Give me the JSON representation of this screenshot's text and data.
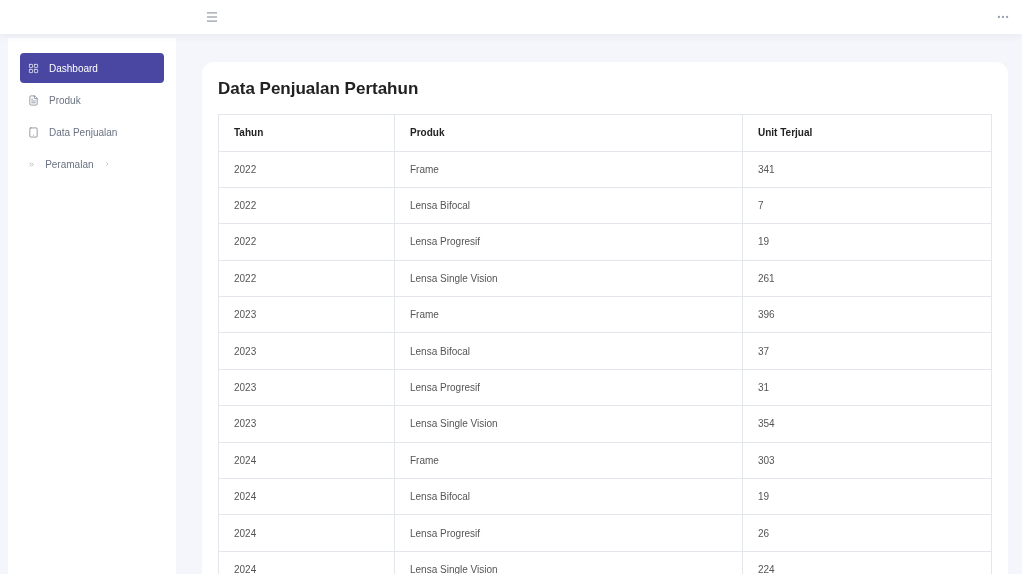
{
  "sidebar": {
    "items": [
      {
        "kind": "grid",
        "label": "Dashboard",
        "selected": true
      },
      {
        "kind": "file",
        "label": "Produk",
        "selected": false
      },
      {
        "kind": "book",
        "label": "Data Penjualan",
        "selected": false
      },
      {
        "kind": "submenu",
        "label": "Peramalan",
        "selected": false
      }
    ]
  },
  "title": "Data Penjualan Pertahun",
  "table": {
    "columns": [
      "Tahun",
      "Produk",
      "Unit Terjual"
    ],
    "rows": [
      [
        "2022",
        "Frame",
        "341"
      ],
      [
        "2022",
        "Lensa Bifocal",
        "7"
      ],
      [
        "2022",
        "Lensa Progresif",
        "19"
      ],
      [
        "2022",
        "Lensa Single Vision",
        "261"
      ],
      [
        "2023",
        "Frame",
        "396"
      ],
      [
        "2023",
        "Lensa Bifocal",
        "37"
      ],
      [
        "2023",
        "Lensa Progresif",
        "31"
      ],
      [
        "2023",
        "Lensa Single Vision",
        "354"
      ],
      [
        "2024",
        "Frame",
        "303"
      ],
      [
        "2024",
        "Lensa Bifocal",
        "19"
      ],
      [
        "2024",
        "Lensa Progresif",
        "26"
      ],
      [
        "2024",
        "Lensa Single Vision",
        "224"
      ]
    ]
  }
}
